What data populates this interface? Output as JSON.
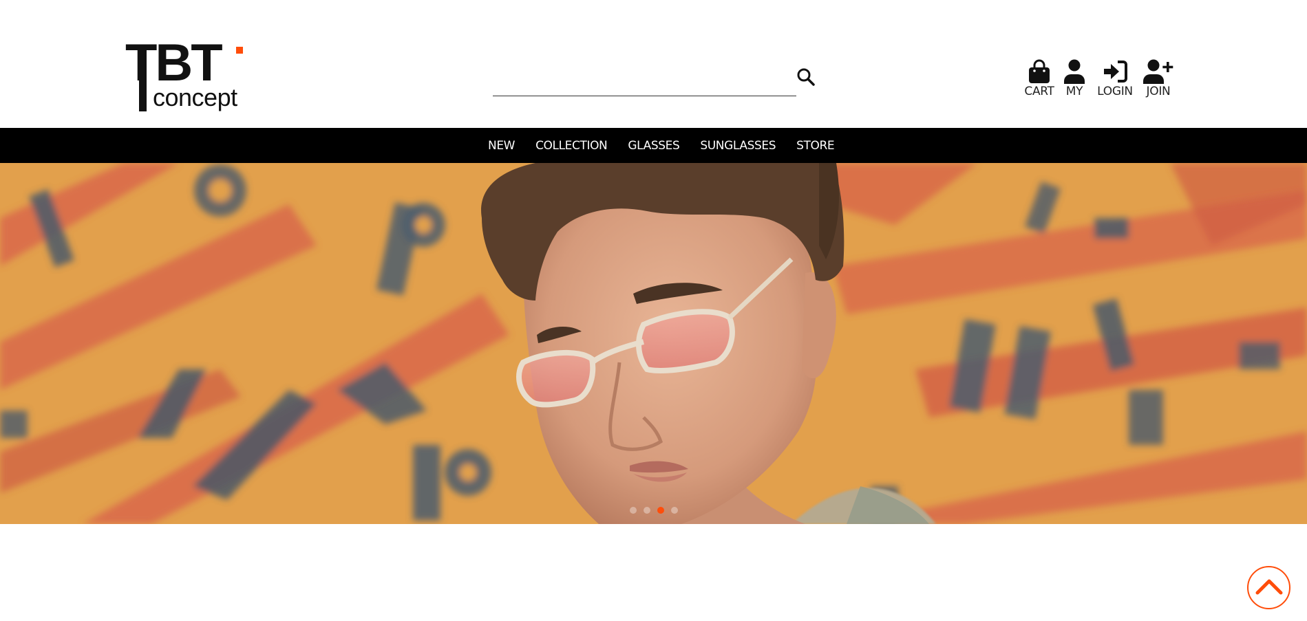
{
  "brand": {
    "logo_top": "TBT",
    "logo_bottom": "concept",
    "accent_color": "#ff4d0a"
  },
  "search": {
    "placeholder": "",
    "value": "",
    "icon": "search-icon"
  },
  "user_nav": {
    "cart": {
      "label": "CART",
      "icon": "shopping-bag-icon"
    },
    "my": {
      "label": "MY",
      "icon": "user-icon"
    },
    "login": {
      "label": "LOGIN",
      "icon": "sign-in-icon"
    },
    "join": {
      "label": "JOIN",
      "icon": "user-plus-icon"
    }
  },
  "menu": {
    "items": [
      "NEW",
      "COLLECTION",
      "GLASSES",
      "SUNGLASSES",
      "STORE"
    ]
  },
  "hero": {
    "slide_count": 4,
    "active_slide": 3
  },
  "back_to_top": {
    "icon": "chevron-up-icon"
  }
}
